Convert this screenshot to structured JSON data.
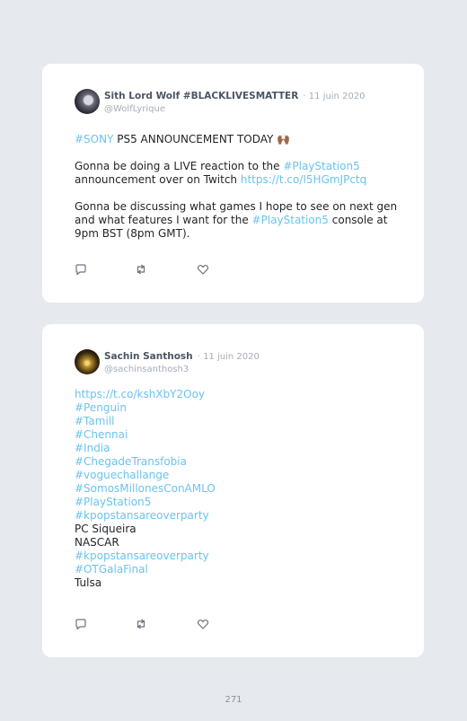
{
  "tweets": [
    {
      "display_name": "Sith Lord Wolf #BLACKLIVESMATTER",
      "date": "· 11 juin 2020",
      "handle": "@WolfLyrique",
      "lines": [
        {
          "parts": [
            {
              "text": "#SONY",
              "link": true
            },
            {
              "text": " PS5 ANNOUNCEMENT TODAY 🙌🏾",
              "link": false
            }
          ]
        },
        {
          "parts": []
        },
        {
          "parts": [
            {
              "text": "Gonna be doing a LIVE reaction to the ",
              "link": false
            },
            {
              "text": "#PlayStation5",
              "link": true
            }
          ]
        },
        {
          "parts": [
            {
              "text": "announcement over on Twitch ",
              "link": false
            },
            {
              "text": "https://t.co/I5HGmJPctq",
              "link": true
            }
          ]
        },
        {
          "parts": []
        },
        {
          "parts": [
            {
              "text": "Gonna be discussing what games I hope to see on next gen",
              "link": false
            }
          ]
        },
        {
          "parts": [
            {
              "text": "and what features I want for the ",
              "link": false
            },
            {
              "text": "#PlayStation5",
              "link": true
            },
            {
              "text": " console at",
              "link": false
            }
          ]
        },
        {
          "parts": [
            {
              "text": "9pm BST (8pm GMT).",
              "link": false
            }
          ]
        }
      ]
    },
    {
      "display_name": "Sachin Santhosh",
      "date": "· 11 juin 2020",
      "handle": "@sachinsanthosh3",
      "lines": [
        {
          "parts": [
            {
              "text": "https://t.co/kshXbY2Ooy",
              "link": true
            }
          ]
        },
        {
          "parts": [
            {
              "text": "#Penguin",
              "link": true
            }
          ]
        },
        {
          "parts": [
            {
              "text": "#Tamill",
              "link": true
            }
          ]
        },
        {
          "parts": [
            {
              "text": "#Chennai",
              "link": true
            }
          ]
        },
        {
          "parts": [
            {
              "text": "#India",
              "link": true
            }
          ]
        },
        {
          "parts": [
            {
              "text": "#ChegadeTransfobia",
              "link": true
            }
          ]
        },
        {
          "parts": [
            {
              "text": "#voguechallange",
              "link": true
            }
          ]
        },
        {
          "parts": [
            {
              "text": "#SomosMillonesConAMLO",
              "link": true
            }
          ]
        },
        {
          "parts": [
            {
              "text": "#PlayStation5",
              "link": true
            }
          ]
        },
        {
          "parts": [
            {
              "text": "#kpopstansareoverparty",
              "link": true
            }
          ]
        },
        {
          "parts": [
            {
              "text": "PC Siqueira",
              "link": false
            }
          ]
        },
        {
          "parts": [
            {
              "text": "NASCAR",
              "link": false
            }
          ]
        },
        {
          "parts": [
            {
              "text": "#kpopstansareoverparty",
              "link": true
            }
          ]
        },
        {
          "parts": [
            {
              "text": "#OTGalaFinal",
              "link": true
            }
          ]
        },
        {
          "parts": [
            {
              "text": "Tulsa",
              "link": false
            }
          ]
        }
      ]
    }
  ],
  "actions": {
    "reply_icon": "reply-icon",
    "retweet_icon": "retweet-icon",
    "like_icon": "heart-icon"
  },
  "page_number": "271",
  "colors": {
    "background": "#e6e9ee",
    "card": "#ffffff",
    "link": "#6cc3ec",
    "name": "#4b5664",
    "muted": "#a6adb6"
  }
}
